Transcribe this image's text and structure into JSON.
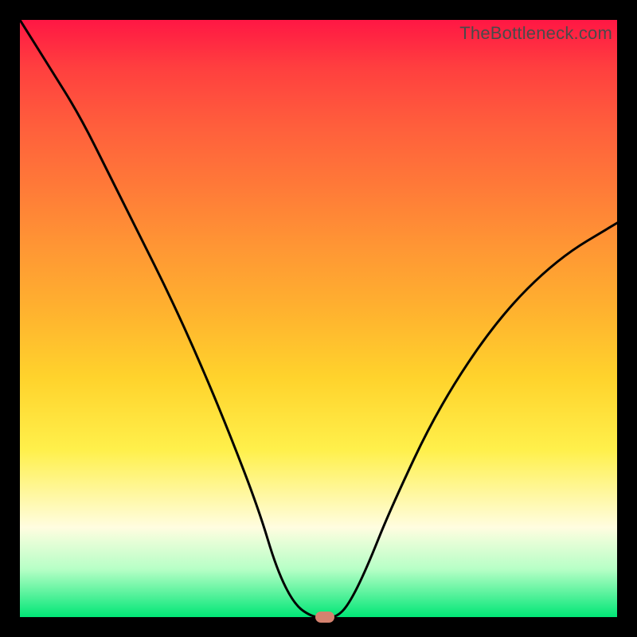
{
  "watermark": "TheBottleneck.com",
  "chart_data": {
    "type": "line",
    "title": "",
    "xlabel": "",
    "ylabel": "",
    "xlim": [
      0,
      100
    ],
    "ylim": [
      0,
      100
    ],
    "x": [
      0,
      5,
      10,
      15,
      20,
      25,
      30,
      35,
      40,
      43,
      46,
      49,
      51,
      53,
      55,
      58,
      62,
      70,
      80,
      90,
      100
    ],
    "values": [
      100,
      92,
      84,
      74,
      64,
      54,
      43,
      31,
      18,
      8,
      2,
      0,
      0,
      0,
      2,
      8,
      18,
      35,
      50,
      60,
      66
    ],
    "marker": {
      "x": 51,
      "y": 0
    },
    "background_gradient": {
      "top": "#ff1744",
      "mid": "#fff04b",
      "bottom": "#00e676"
    }
  }
}
